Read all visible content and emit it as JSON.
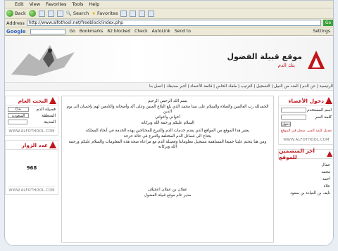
{
  "menu": [
    "Edit",
    "View",
    "Favorites",
    "Tools",
    "Help"
  ],
  "toolbar": {
    "back": "Back",
    "search": "Search",
    "favorites": "Favorites"
  },
  "address": {
    "label": "Address",
    "url": "http://www.alfothool.net/freeblock/index.php",
    "go": "Go"
  },
  "googlebar": {
    "logo": "Google",
    "go": "Go",
    "bookmarks": "Bookmarks",
    "blocked": "82 blocked",
    "check": "Check",
    "autolink": "AutoLink",
    "sendto": "Send to",
    "settings": "Settings"
  },
  "site": {
    "title": "موقع قبيلة الفضول",
    "subtitle": "بنك الدم"
  },
  "nav": [
    "الرئيسية",
    "عن الدم",
    "العدد من النبيل",
    "التسجيل",
    "الترتيب",
    "ملفك الخاص",
    "قائمة الأعضاء",
    "أخبر صديقك",
    "اتصل بنا"
  ],
  "left": {
    "search_title": "البحث العام",
    "fields": [
      {
        "label": "فصيلة الدم",
        "value": "O+"
      },
      {
        "label": "المنطقة",
        "value": "السعودية"
      },
      {
        "label": "المدينة",
        "value": ""
      }
    ],
    "site_footer": "WWW.ALFOTHOOL.COM",
    "visitors_title": "عدد الزوار",
    "visitors": "968"
  },
  "center": {
    "lines": [
      "بسم الله الرحمن الرحيم",
      "الحمدلله رب العالمين والصلاة والسلام على نبينا محمد الذي بلغ البلاغ المبين وعلى آله وأصحابه والتابعين لهم بإحسان الى يوم الدين",
      "أخواني وأخواتي",
      "السلام عليكم ورحمة الله وبركاته",
      "يعتبر هذا الموقع من المواقع الذي يقدم خدمات الدم والتبرع للمحتاجين بهذه الخدمة في أنحاء المملكة",
      "يحتاج الى فصائل الدم المختلفة والتبرع في حالة حرجة",
      "ومن هنا يتحتم علينا جميعا المساهمة بتسجيل معلوماتنا وفصيلة الدم مع مراعاة صحة هذه المعلومات والسلام عليكم ورحمة الله وبركاته"
    ],
    "signature": [
      "عقلان بن عقلان اعجيلان",
      "مدير عام موقع قبيلة الفضول"
    ]
  },
  "right": {
    "login_title": "دخول الأعضاء",
    "username_label": "اسم المستخدم",
    "password_label": "كلمة السر",
    "login_button": "دخول",
    "forgot": "تعديل كلمة السر",
    "register": "سجل في الموقع",
    "site_footer": "WWW.ALFOTHOOL.COM",
    "members_title": "آخر المنضمين للموقع",
    "members": [
      "جمال",
      "محمد",
      "أحمد",
      "علاء",
      "نايف بن العيادة بن سعود"
    ]
  }
}
